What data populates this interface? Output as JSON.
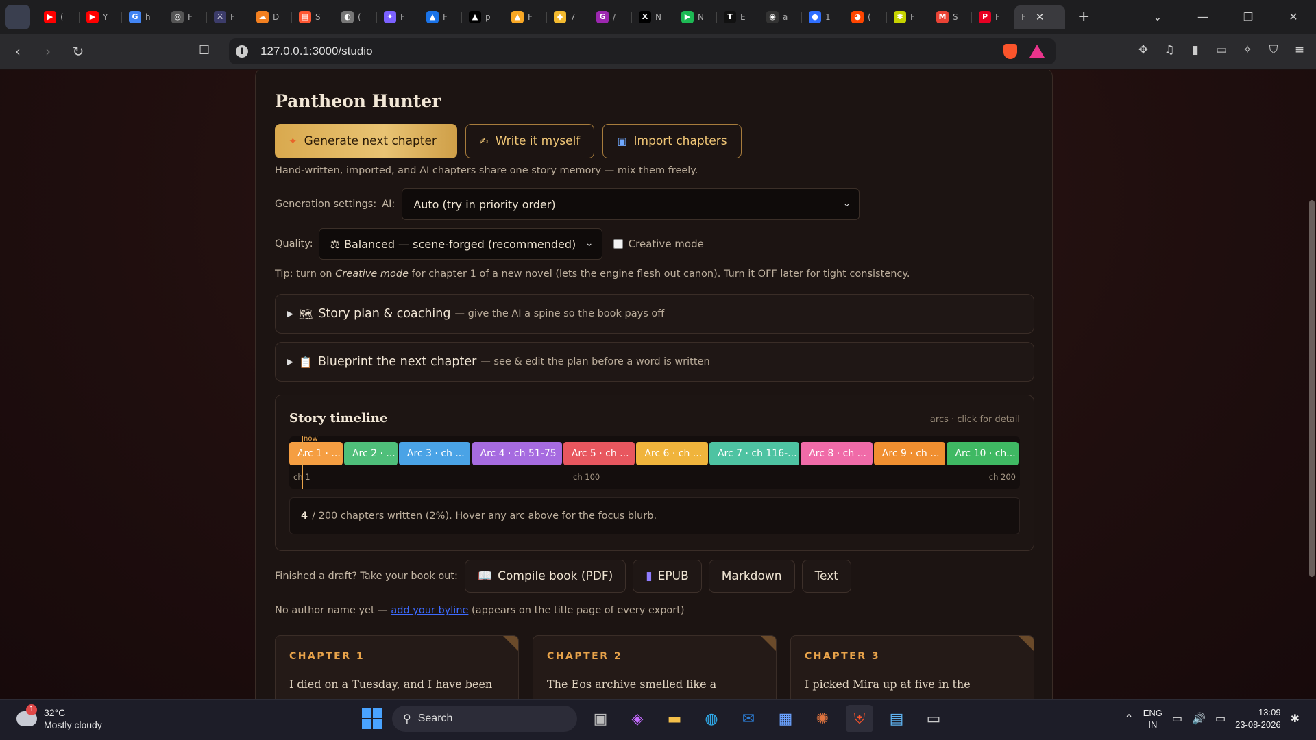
{
  "browser": {
    "tabs": [
      {
        "icon": "youtube-icon",
        "letter": "▶",
        "color": "#ff0000",
        "label": "("
      },
      {
        "icon": "youtube-icon",
        "letter": "▶",
        "color": "#ff0000",
        "label": "Y"
      },
      {
        "icon": "google-icon",
        "letter": "G",
        "color": "#4285f4",
        "label": "h"
      },
      {
        "icon": "openai-icon",
        "letter": "◎",
        "color": "#555555",
        "label": "F"
      },
      {
        "icon": "app-icon",
        "letter": "⚔",
        "color": "#3c3c6a",
        "label": "F"
      },
      {
        "icon": "cloud-icon",
        "letter": "☁",
        "color": "#f38020",
        "label": "D"
      },
      {
        "icon": "stack-icon",
        "letter": "▤",
        "color": "#ff5733",
        "label": "S"
      },
      {
        "icon": "globe-icon",
        "letter": "◐",
        "color": "#777777",
        "label": "("
      },
      {
        "icon": "ai-icon",
        "letter": "✦",
        "color": "#7b61ff",
        "label": "F"
      },
      {
        "icon": "ads-icon",
        "letter": "▲",
        "color": "#1a73e8",
        "label": "F"
      },
      {
        "icon": "vercel-icon",
        "letter": "▲",
        "color": "#000000",
        "label": "p"
      },
      {
        "icon": "flame-icon",
        "letter": "▲",
        "color": "#f9a825",
        "label": "F"
      },
      {
        "icon": "binance-icon",
        "letter": "◆",
        "color": "#f3ba2f",
        "label": "7"
      },
      {
        "icon": "g-icon",
        "letter": "G",
        "color": "#9c27b0",
        "label": "/"
      },
      {
        "icon": "x-icon",
        "letter": "X",
        "color": "#000000",
        "label": "N"
      },
      {
        "icon": "play-icon",
        "letter": "▶",
        "color": "#1db954",
        "label": "N"
      },
      {
        "icon": "tt-icon",
        "letter": "T",
        "color": "#111111",
        "label": "E"
      },
      {
        "icon": "github-icon",
        "letter": "◉",
        "color": "#333333",
        "label": "a"
      },
      {
        "icon": "toggle-icon",
        "letter": "●",
        "color": "#2f6fff",
        "label": "1"
      },
      {
        "icon": "reddit-icon",
        "letter": "◕",
        "color": "#ff4500",
        "label": "("
      },
      {
        "icon": "star-icon",
        "letter": "✱",
        "color": "#c6d300",
        "label": "F"
      },
      {
        "icon": "gmail-icon",
        "letter": "M",
        "color": "#ea4335",
        "label": "S"
      },
      {
        "icon": "p-icon",
        "letter": "P",
        "color": "#e60023",
        "label": "F"
      }
    ],
    "active_tab_label": "F",
    "url": "127.0.0.1:3000/studio"
  },
  "studio": {
    "title": "Pantheon Hunter",
    "generate_label": "Generate next chapter",
    "write_label": "Write it myself",
    "import_label": "Import chapters",
    "memory_note": "Hand-written, imported, and AI chapters share one story memory — mix them freely.",
    "gen_settings_label": "Generation settings:",
    "ai_label": "AI:",
    "ai_value": "Auto (try in priority order)",
    "quality_label": "Quality:",
    "quality_value": "Balanced — scene-forged (recommended)",
    "creative_label": "Creative mode",
    "tip_prefix": "Tip: turn on",
    "tip_em": "Creative mode",
    "tip_suffix": "for chapter 1 of a new novel (lets the engine flesh out canon). Turn it OFF later for tight consistency.",
    "story_plan_title": "Story plan & coaching",
    "story_plan_sub": "— give the AI a spine so the book pays off",
    "blueprint_title": "Blueprint the next chapter",
    "blueprint_sub": "— see & edit the plan before a word is written"
  },
  "timeline": {
    "title": "Story timeline",
    "hint": "arcs · click for detail",
    "now_label": "now",
    "arcs": [
      {
        "label": "Arc 1 · ...",
        "color": "#f59e42",
        "start": 1,
        "end": 15
      },
      {
        "label": "Arc 2 · ...",
        "color": "#4fbf7a",
        "start": 16,
        "end": 30
      },
      {
        "label": "Arc 3 · ch ...",
        "color": "#4aa3e6",
        "start": 31,
        "end": 50
      },
      {
        "label": "Arc 4 · ch 51-75",
        "color": "#a66be0",
        "start": 51,
        "end": 75
      },
      {
        "label": "Arc 5 · ch ...",
        "color": "#e8575f",
        "start": 76,
        "end": 95
      },
      {
        "label": "Arc 6 · ch ...",
        "color": "#f0b43c",
        "start": 96,
        "end": 115
      },
      {
        "label": "Arc 7 · ch 116-...",
        "color": "#4ec3a2",
        "start": 116,
        "end": 140
      },
      {
        "label": "Arc 8 · ch ...",
        "color": "#f06ba8",
        "start": 141,
        "end": 160
      },
      {
        "label": "Arc 9 · ch ...",
        "color": "#f08f30",
        "start": 161,
        "end": 180
      },
      {
        "label": "Arc 10 · ch...",
        "color": "#3fb963",
        "start": 181,
        "end": 200
      }
    ],
    "total_chapters": 200,
    "current_chapter": 4,
    "ticks": [
      "ch 1",
      "ch 100",
      "ch 200"
    ],
    "status_count": "4",
    "status_text": "/ 200 chapters written (2%). Hover any arc above for the focus blurb."
  },
  "export": {
    "label": "Finished a draft? Take your book out:",
    "pdf_label": "Compile book (PDF)",
    "epub_label": "EPUB",
    "md_label": "Markdown",
    "text_label": "Text",
    "byline_prefix": "No author name yet —",
    "byline_link": "add your byline",
    "byline_suffix": "(appears on the title page of every export)"
  },
  "chapters": [
    {
      "label": "CHAPTER 1",
      "excerpt": "I died on a Tuesday, and I have been"
    },
    {
      "label": "CHAPTER 2",
      "excerpt": "The Eos archive smelled like a"
    },
    {
      "label": "CHAPTER 3",
      "excerpt": "I picked Mira up at five in the"
    }
  ],
  "taskbar": {
    "temp": "32°C",
    "weather": "Mostly cloudy",
    "weather_badge": "1",
    "search_label": "Search",
    "lang1": "ENG",
    "lang2": "IN",
    "time": "13:09",
    "date": "23-08-2026"
  }
}
